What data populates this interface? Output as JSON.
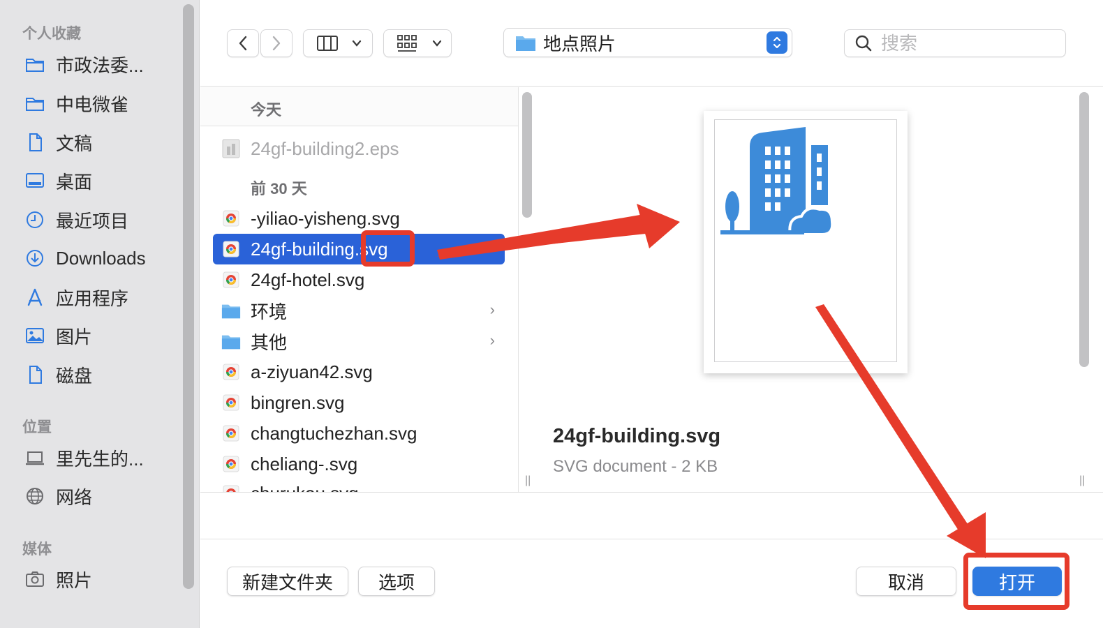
{
  "sidebar": {
    "sections": [
      {
        "label": "个人收藏"
      },
      {
        "label": "位置"
      },
      {
        "label": "媒体"
      }
    ],
    "favorites": [
      {
        "label": "市政法委...",
        "icon": "folder-icon"
      },
      {
        "label": "中电微雀",
        "icon": "folder-icon"
      },
      {
        "label": "文稿",
        "icon": "document-icon"
      },
      {
        "label": "桌面",
        "icon": "desktop-icon"
      },
      {
        "label": "最近项目",
        "icon": "clock-icon"
      },
      {
        "label": "Downloads",
        "icon": "download-icon"
      },
      {
        "label": "应用程序",
        "icon": "applications-icon"
      },
      {
        "label": "图片",
        "icon": "pictures-icon"
      },
      {
        "label": "磁盘",
        "icon": "document-icon"
      }
    ],
    "locations": [
      {
        "label": "里先生的...",
        "icon": "laptop-icon"
      },
      {
        "label": "网络",
        "icon": "globe-icon"
      }
    ],
    "media": [
      {
        "label": "照片",
        "icon": "camera-icon"
      }
    ]
  },
  "toolbar": {
    "location": "地点照片",
    "search_placeholder": "搜索"
  },
  "filelist": {
    "groups": [
      {
        "label": "今天"
      },
      {
        "label": "前 30 天"
      }
    ],
    "files": [
      {
        "name": "24gf-building2.eps",
        "type": "eps",
        "dim": true
      },
      {
        "name": "-yiliao-yisheng.svg",
        "type": "svg"
      },
      {
        "name": "24gf-building.svg",
        "type": "svg",
        "selected": true
      },
      {
        "name": "24gf-hotel.svg",
        "type": "svg"
      },
      {
        "name": "环境",
        "type": "folder"
      },
      {
        "name": "其他",
        "type": "folder"
      },
      {
        "name": "a-ziyuan42.svg",
        "type": "svg"
      },
      {
        "name": "bingren.svg",
        "type": "svg"
      },
      {
        "name": "changtuchezhan.svg",
        "type": "svg"
      },
      {
        "name": "cheliang-.svg",
        "type": "svg"
      },
      {
        "name": "churukou.svg",
        "type": "svg"
      }
    ]
  },
  "preview": {
    "name": "24gf-building.svg",
    "kind": "SVG document - 2 KB"
  },
  "buttons": {
    "new_folder": "新建文件夹",
    "options": "选项",
    "cancel": "取消",
    "open": "打开"
  },
  "colors": {
    "accent": "#2f7ae0",
    "selection": "#2a62d8",
    "annotation": "#e63b2b",
    "icon_blue": "#3d8bd9"
  }
}
